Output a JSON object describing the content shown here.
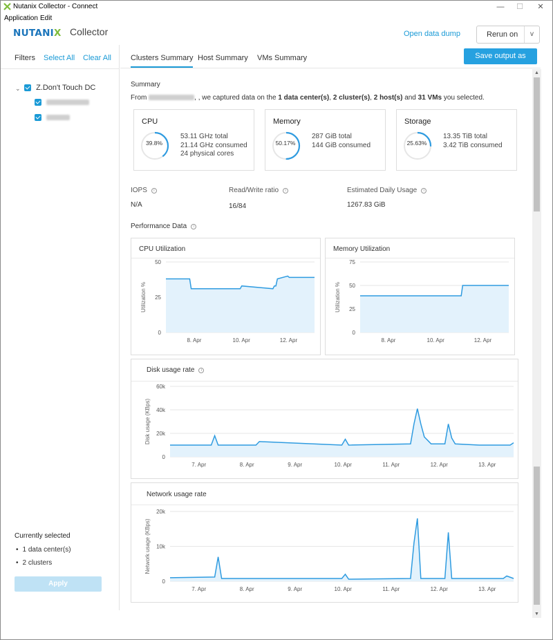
{
  "window": {
    "title": "Nutanix Collector - Connect",
    "menu": [
      "Application",
      "Edit"
    ],
    "controls": {
      "minimize": "—",
      "maximize": "☐",
      "close": "✕"
    }
  },
  "header": {
    "brand_main": "NUTANI",
    "brand_x": "X",
    "brand_sub": "Collector",
    "open_dump": "Open data dump",
    "rerun": "Rerun on",
    "rerun_chevron": "v"
  },
  "sidebar": {
    "filters_label": "Filters",
    "select_all": "Select All",
    "clear_all": "Clear All",
    "tree": {
      "datacenter": "Z.Don't Touch DC"
    },
    "currently_selected_title": "Currently selected",
    "currently_selected": [
      "1 data center(s)",
      "2 clusters"
    ],
    "apply": "Apply"
  },
  "tabs": [
    "Clusters Summary",
    "Host Summary",
    "VMs Summary"
  ],
  "save_output": "Save output as .XLSX",
  "summary": {
    "title": "Summary",
    "from_prefix": "From",
    "from_mid": ", we captured data on the",
    "dc": "1 data center(s)",
    "clusters": "2 cluster(s)",
    "hosts": "2 host(s)",
    "and": "and",
    "vms": "31 VMs",
    "suffix": "you selected.",
    "comma": ","
  },
  "cards": [
    {
      "title": "CPU",
      "percent_label": "39.8%",
      "percent": 39.8,
      "lines": [
        "53.11 GHz total",
        "21.14 GHz consumed",
        "24 physical cores"
      ]
    },
    {
      "title": "Memory",
      "percent_label": "50.17%",
      "percent": 50.17,
      "lines": [
        "287 GiB total",
        "144 GiB consumed"
      ]
    },
    {
      "title": "Storage",
      "percent_label": "25.63%",
      "percent": 25.63,
      "lines": [
        "13.35 TiB total",
        "3.42 TiB consumed"
      ]
    }
  ],
  "metrics": [
    {
      "label": "IOPS",
      "value": "N/A"
    },
    {
      "label": "Read/Write ratio",
      "value": "16/84"
    },
    {
      "label": "Estimated Daily Usage",
      "value": "1267.83 GiB"
    }
  ],
  "performance_title": "Performance Data",
  "charts": {
    "cpu": {
      "title": "CPU Utilization",
      "ylabel": "Utilization %",
      "yticks": [
        "0",
        "25",
        "50"
      ],
      "xticks": [
        "8. Apr",
        "10. Apr",
        "12. Apr"
      ],
      "ylim": [
        0,
        50
      ],
      "x": [
        0,
        0.16,
        0.17,
        0.5,
        0.51,
        0.72,
        0.73,
        0.74,
        0.75,
        0.82,
        0.83,
        1.0
      ],
      "y": [
        38,
        38,
        31,
        31,
        33,
        31,
        33,
        33,
        38,
        40,
        39,
        39
      ]
    },
    "memory": {
      "title": "Memory Utilization",
      "ylabel": "Utilization %",
      "yticks": [
        "0",
        "25",
        "50",
        "75"
      ],
      "xticks": [
        "8. Apr",
        "10. Apr",
        "12. Apr"
      ],
      "ylim": [
        0,
        75
      ],
      "x": [
        0,
        0.68,
        0.69,
        1.0
      ],
      "y": [
        39,
        39,
        50,
        50
      ]
    },
    "disk": {
      "title": "Disk usage rate",
      "ylabel": "Disk usage (KBps)",
      "yticks": [
        "0",
        "20k",
        "40k",
        "60k"
      ],
      "xticks": [
        "7. Apr",
        "8. Apr",
        "9. Apr",
        "10. Apr",
        "11. Apr",
        "12. Apr",
        "13. Apr"
      ],
      "ylim": [
        0,
        60000
      ],
      "x": [
        0,
        0.12,
        0.13,
        0.14,
        0.25,
        0.26,
        0.5,
        0.51,
        0.52,
        0.7,
        0.71,
        0.72,
        0.73,
        0.74,
        0.75,
        0.76,
        0.8,
        0.81,
        0.82,
        0.83,
        0.9,
        0.99,
        1.0
      ],
      "y": [
        10000,
        10000,
        18000,
        10000,
        10000,
        13000,
        10000,
        15000,
        10000,
        11000,
        28000,
        41000,
        28000,
        17000,
        14000,
        11000,
        11000,
        28000,
        16000,
        11000,
        10000,
        10000,
        12000
      ]
    },
    "network": {
      "title": "Network usage rate",
      "ylabel": "Network usage (KBps)",
      "yticks": [
        "0",
        "10k",
        "20k"
      ],
      "xticks": [
        "7. Apr",
        "8. Apr",
        "9. Apr",
        "10. Apr",
        "11. Apr",
        "12. Apr",
        "13. Apr"
      ],
      "ylim": [
        0,
        20000
      ],
      "x": [
        0,
        0.13,
        0.14,
        0.15,
        0.5,
        0.51,
        0.52,
        0.7,
        0.71,
        0.72,
        0.73,
        0.8,
        0.81,
        0.82,
        0.97,
        0.98,
        1.0
      ],
      "y": [
        1000,
        1200,
        7000,
        800,
        800,
        2000,
        600,
        800,
        11000,
        18000,
        800,
        800,
        14000,
        800,
        800,
        1500,
        800
      ]
    }
  },
  "colors": {
    "accent": "#1a9ad6",
    "line": "#2e9be0",
    "fill": "#e3f2fc",
    "grid": "#e6e6e6"
  }
}
